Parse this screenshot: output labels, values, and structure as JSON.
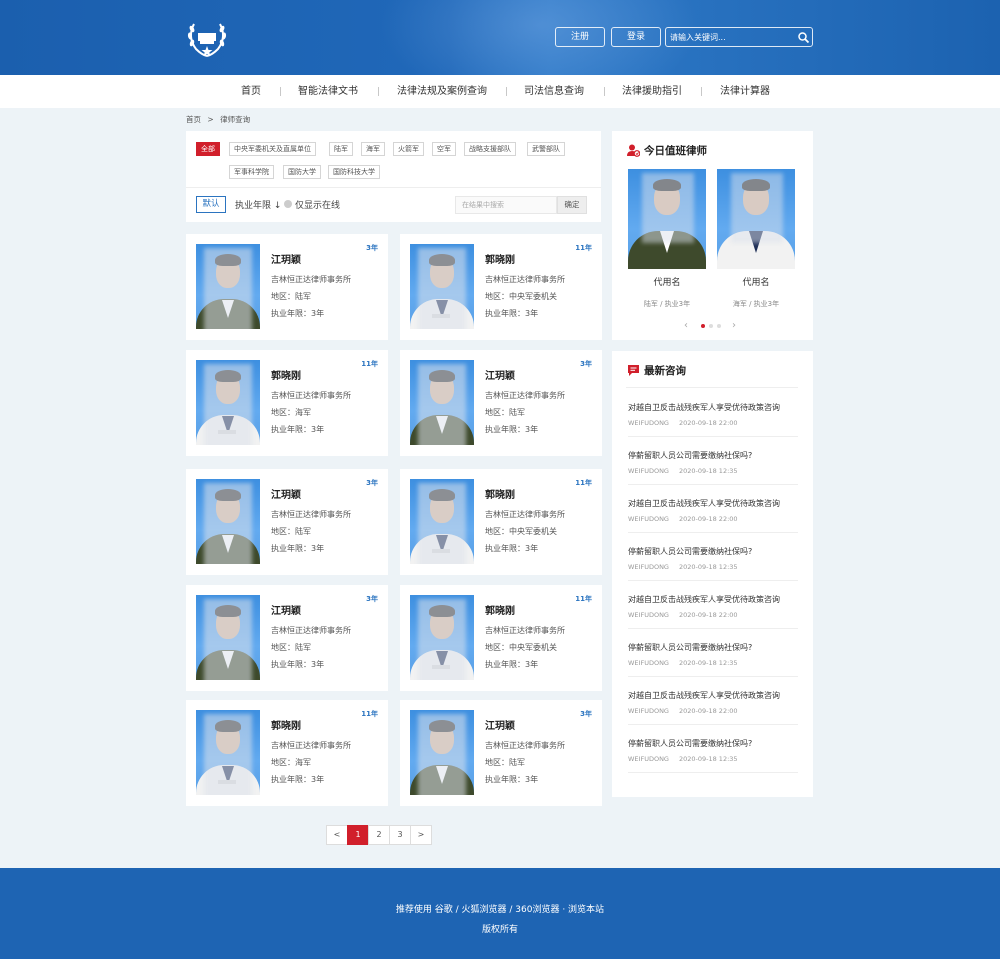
{
  "header": {
    "register_label": "注册",
    "login_label": "登录",
    "search_placeholder": "请输入关键词...",
    "accent_color": "#1e64b3"
  },
  "nav": {
    "items": [
      {
        "label": "首页"
      },
      {
        "label": "智能法律文书"
      },
      {
        "label": "法律法规及案例查询"
      },
      {
        "label": "司法信息查询"
      },
      {
        "label": "法律援助指引"
      },
      {
        "label": "法律计算器"
      }
    ]
  },
  "breadcrumb": {
    "home": "首页",
    "separator": ">",
    "current": "律师查询"
  },
  "filters": {
    "tags": [
      {
        "label": "全部",
        "active": true
      },
      {
        "label": "中央军委机关及直属单位"
      },
      {
        "label": "陆军"
      },
      {
        "label": "海军"
      },
      {
        "label": "火箭军"
      },
      {
        "label": "空军"
      },
      {
        "label": "战略支援部队"
      },
      {
        "label": "武警部队"
      },
      {
        "label": "军事科学院"
      },
      {
        "label": "国防大学"
      },
      {
        "label": "国防科技大学"
      }
    ],
    "sort_default": "默认",
    "sort_years": "执业年限 ↓",
    "online_only": "仅显示在线",
    "result_search_placeholder": "在结果中搜索",
    "result_search_button": "确定"
  },
  "lawyers": [
    {
      "name": "江玥颖",
      "badge": "3年",
      "firm": "吉林恒正达律师事务所",
      "region": "地区：陆军",
      "years": "执业年限：3年",
      "uniform": "army"
    },
    {
      "name": "郭晓刚",
      "badge": "11年",
      "firm": "吉林恒正达律师事务所",
      "region": "地区：中央军委机关",
      "years": "执业年限：3年",
      "uniform": "navy"
    },
    {
      "name": "郭晓刚",
      "badge": "11年",
      "firm": "吉林恒正达律师事务所",
      "region": "地区：海军",
      "years": "执业年限：3年",
      "uniform": "navy"
    },
    {
      "name": "江玥颖",
      "badge": "3年",
      "firm": "吉林恒正达律师事务所",
      "region": "地区：陆军",
      "years": "执业年限：3年",
      "uniform": "army"
    },
    {
      "name": "江玥颖",
      "badge": "3年",
      "firm": "吉林恒正达律师事务所",
      "region": "地区：陆军",
      "years": "执业年限：3年",
      "uniform": "army"
    },
    {
      "name": "郭晓刚",
      "badge": "11年",
      "firm": "吉林恒正达律师事务所",
      "region": "地区：中央军委机关",
      "years": "执业年限：3年",
      "uniform": "navy"
    },
    {
      "name": "江玥颖",
      "badge": "3年",
      "firm": "吉林恒正达律师事务所",
      "region": "地区：陆军",
      "years": "执业年限：3年",
      "uniform": "army"
    },
    {
      "name": "郭晓刚",
      "badge": "11年",
      "firm": "吉林恒正达律师事务所",
      "region": "地区：中央军委机关",
      "years": "执业年限：3年",
      "uniform": "navy"
    },
    {
      "name": "郭晓刚",
      "badge": "11年",
      "firm": "吉林恒正达律师事务所",
      "region": "地区：海军",
      "years": "执业年限：3年",
      "uniform": "navy"
    },
    {
      "name": "江玥颖",
      "badge": "3年",
      "firm": "吉林恒正达律师事务所",
      "region": "地区：陆军",
      "years": "执业年限：3年",
      "uniform": "army"
    }
  ],
  "pagination": {
    "prev": "<",
    "pages": [
      "1",
      "2",
      "3"
    ],
    "current": "1",
    "next": ">"
  },
  "duty": {
    "title": "今日值班律师",
    "lawyers": [
      {
        "name": "代用名",
        "meta": "陆军 / 执业3年",
        "uniform": "army"
      },
      {
        "name": "代用名",
        "meta": "海军 / 执业3年",
        "uniform": "navy"
      }
    ],
    "prev": "‹",
    "next": "›"
  },
  "consult": {
    "title": "最新咨询",
    "items": [
      {
        "q": "对越自卫反击战残疾军人享受优待政策咨询",
        "user": "WEIFUDONG",
        "date": "2020-09-18 22:00"
      },
      {
        "q": "停薪留职人员公司需要缴纳社保吗?",
        "user": "WEIFUDONG",
        "date": "2020-09-18 12:35"
      },
      {
        "q": "对越自卫反击战残疾军人享受优待政策咨询",
        "user": "WEIFUDONG",
        "date": "2020-09-18 22:00"
      },
      {
        "q": "停薪留职人员公司需要缴纳社保吗?",
        "user": "WEIFUDONG",
        "date": "2020-09-18 12:35"
      },
      {
        "q": "对越自卫反击战残疾军人享受优待政策咨询",
        "user": "WEIFUDONG",
        "date": "2020-09-18 22:00"
      },
      {
        "q": "停薪留职人员公司需要缴纳社保吗?",
        "user": "WEIFUDONG",
        "date": "2020-09-18 12:35"
      },
      {
        "q": "对越自卫反击战残疾军人享受优待政策咨询",
        "user": "WEIFUDONG",
        "date": "2020-09-18 22:00"
      },
      {
        "q": "停薪留职人员公司需要缴纳社保吗?",
        "user": "WEIFUDONG",
        "date": "2020-09-18 12:35"
      }
    ]
  },
  "footer": {
    "line1": "推荐使用 谷歌 / 火狐浏览器 / 360浏览器 · 浏览本站",
    "line2": "版权所有"
  }
}
